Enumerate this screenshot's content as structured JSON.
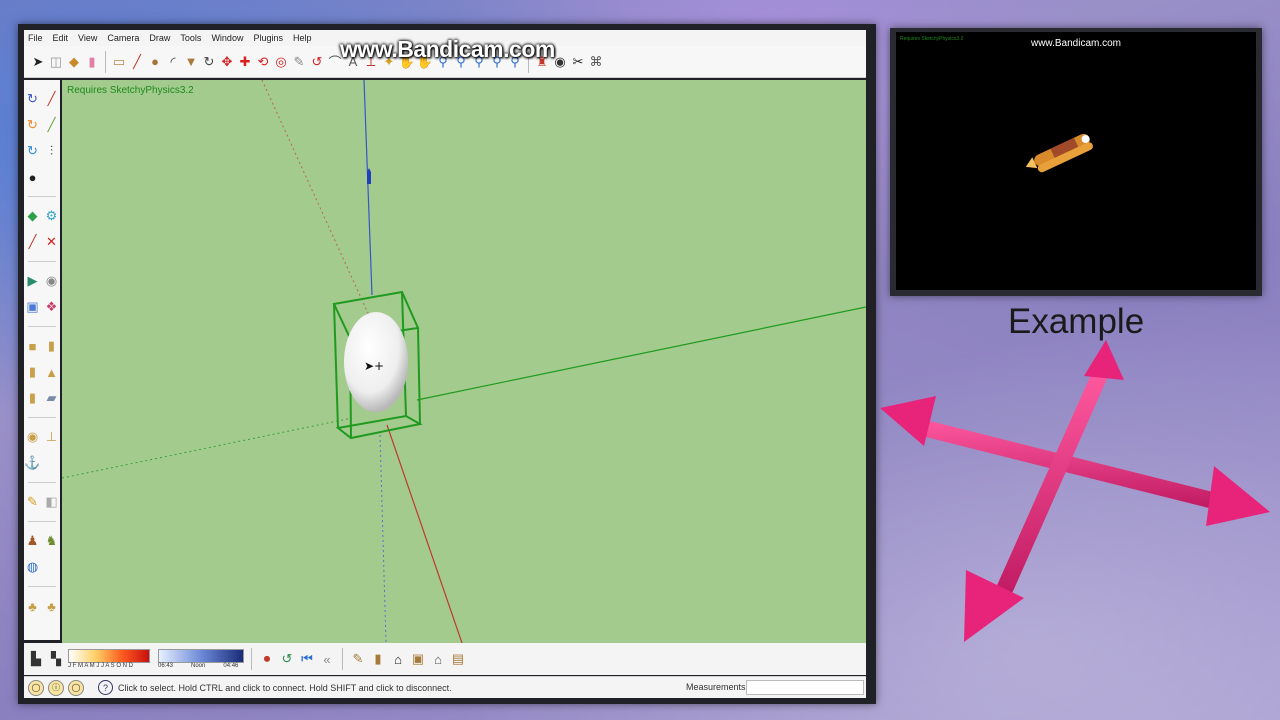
{
  "watermark": "www.Bandicam.com",
  "menu": [
    "File",
    "Edit",
    "View",
    "Camera",
    "Draw",
    "Tools",
    "Window",
    "Plugins",
    "Help"
  ],
  "viewport": {
    "label": "Requires SketchyPhysics3.2",
    "background_color": "#a3cb8e"
  },
  "statusbar": {
    "hint": "Click to select. Hold CTRL and click to connect. Hold SHIFT and click to disconnect.",
    "measurements_label": "Measurements",
    "measurements_value": ""
  },
  "bottom_toolbar": {
    "warm_scale": "J F M A M J J A S O N D",
    "time_a": "06:43",
    "noon": "Noon",
    "time_b": "04:46"
  },
  "preview": {
    "watermark": "www.Bandicam.com",
    "label": "Requires SketchyPhysics3.2"
  },
  "example": {
    "title": "Example",
    "arrow_color": "#e8237a"
  },
  "icons": {
    "top": [
      "select-icon",
      "component-icon",
      "paint-bucket-icon",
      "eraser-icon",
      "rectangle-icon",
      "pencil-icon",
      "circle-icon",
      "arc-icon",
      "pushpull-icon",
      "rotate-icon",
      "move-icon",
      "scale-icon",
      "followme-icon",
      "offset-icon",
      "tape-icon",
      "dimension-icon",
      "protractor-icon",
      "text-icon",
      "axes-icon",
      "3dtext-icon",
      "orbit-icon",
      "pan-icon",
      "zoom-icon",
      "zoom-window-icon",
      "zoom-extents-icon",
      "prev-view-icon",
      "walk-icon",
      "lookaround-icon",
      "position-camera-icon",
      "section-icon"
    ],
    "left": [
      "orbit-icon",
      "pencil-icon",
      "joint-hinge-icon",
      "joint-line-icon",
      "joint-servo-icon",
      "joint-piston-icon",
      "sphere-ball-icon",
      "magnet-icon",
      "thruster-icon",
      "emitter-icon",
      "pin-icon",
      "delete-icon",
      "play-icon",
      "pause-icon",
      "ui-icon",
      "settings-icon",
      "box-icon",
      "cylinder-icon",
      "cone-icon",
      "capsule-icon",
      "wheel-icon",
      "chamfer-icon",
      "spring-icon",
      "anchor-icon",
      "joint-connect-icon",
      "joint-disconnect-icon",
      "figure-icon",
      "figure2-icon",
      "globe-icon",
      "camera-icon",
      "hand-icon"
    ],
    "bottom": [
      "shadow-icon",
      "fog-icon",
      "record-icon",
      "rewind-icon",
      "step-back-icon",
      "prev-icon",
      "tool-a-icon",
      "tool-b-icon",
      "house-icon",
      "door-icon",
      "roof-icon",
      "wall-icon"
    ]
  }
}
